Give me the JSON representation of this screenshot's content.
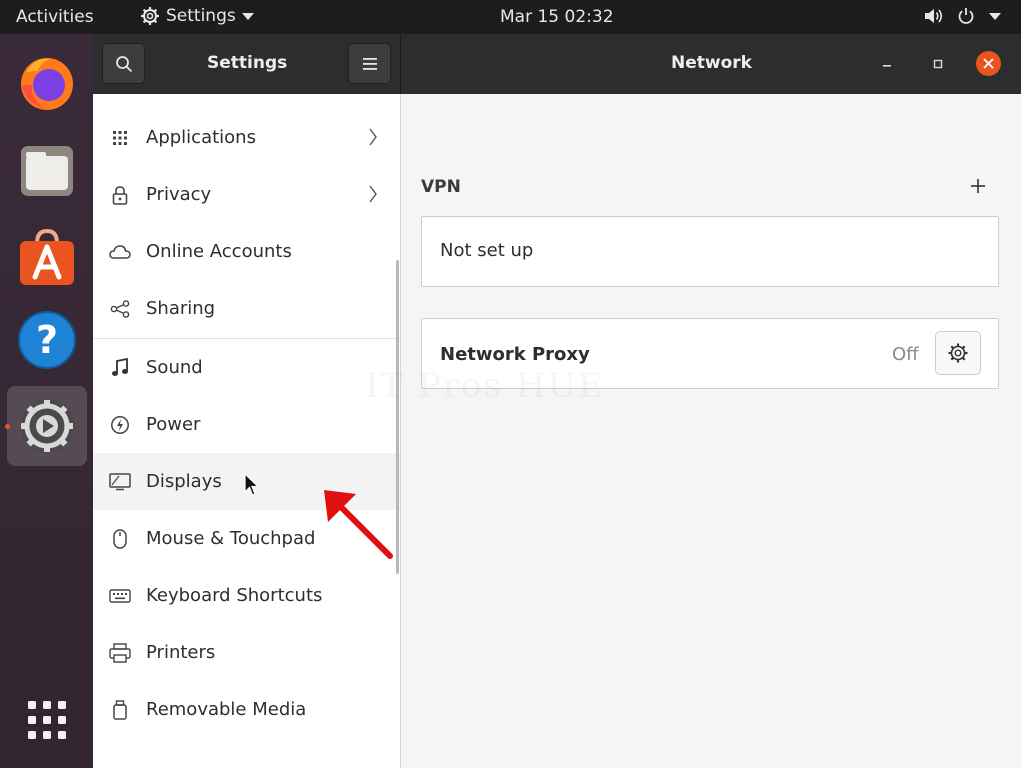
{
  "topbar": {
    "activities": "Activities",
    "app_menu": "Settings",
    "clock": "Mar 15  02:32"
  },
  "dock": {
    "items": [
      {
        "name": "firefox-icon"
      },
      {
        "name": "files-icon"
      },
      {
        "name": "software-icon"
      },
      {
        "name": "help-icon"
      },
      {
        "name": "settings-icon",
        "active": true
      }
    ]
  },
  "window": {
    "sidebar_title": "Settings",
    "content_title": "Network"
  },
  "sidebar": {
    "items": [
      {
        "label": "Applications",
        "icon": "grid-icon"
      },
      {
        "label": "Privacy",
        "icon": "lock-icon"
      },
      {
        "label": "Online Accounts",
        "icon": "cloud-icon"
      },
      {
        "label": "Sharing",
        "icon": "share-icon"
      },
      {
        "label": "Sound",
        "icon": "music-note-icon"
      },
      {
        "label": "Power",
        "icon": "power-icon"
      },
      {
        "label": "Displays",
        "icon": "display-icon"
      },
      {
        "label": "Mouse & Touchpad",
        "icon": "mouse-icon"
      },
      {
        "label": "Keyboard Shortcuts",
        "icon": "keyboard-icon"
      },
      {
        "label": "Printers",
        "icon": "printer-icon"
      },
      {
        "label": "Removable Media",
        "icon": "removable-media-icon"
      }
    ]
  },
  "network": {
    "vpn": {
      "title": "VPN",
      "status": "Not set up"
    },
    "proxy": {
      "title": "Network Proxy",
      "state": "Off"
    }
  },
  "watermark": "IT Pros HUE",
  "colors": {
    "accent": "#e95420",
    "headerbar": "#2d2d2d",
    "topbar": "#1d1d1d",
    "annotation_arrow": "#e01010"
  }
}
